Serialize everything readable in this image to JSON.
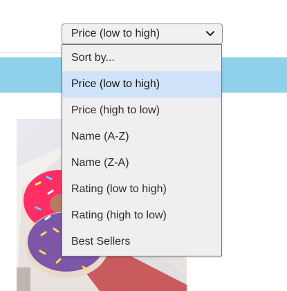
{
  "sort_select": {
    "selected_label": "Price (low to high)",
    "options": [
      "Sort by...",
      "Price (low to high)",
      "Price (high to low)",
      "Name (A-Z)",
      "Name (Z-A)",
      "Rating (low to high)",
      "Rating (high to low)",
      "Best Sellers"
    ],
    "highlighted_option": "Price (low to high)",
    "chevron_icon": "chevron-down-icon"
  },
  "colors": {
    "banner": "#8fd1eb",
    "option_highlight": "#cfe3f8",
    "dropdown_background": "#efefef"
  },
  "product": {
    "image_icon": "donut-box-photo"
  }
}
